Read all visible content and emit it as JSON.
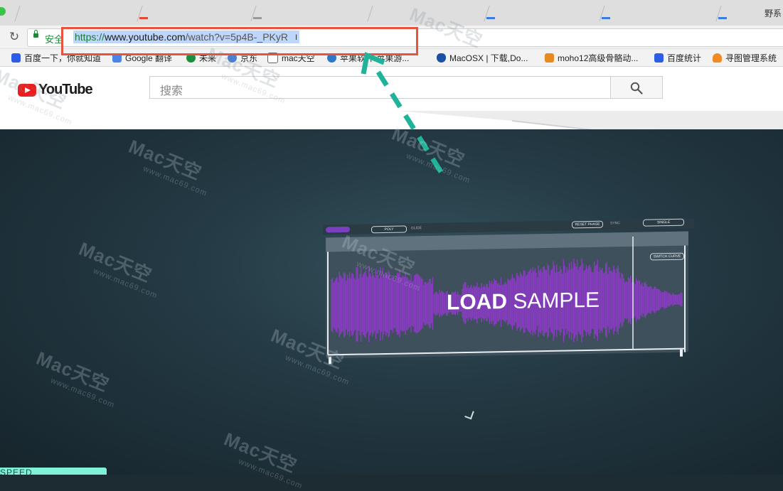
{
  "browser": {
    "corner_text": "野系",
    "secure_label": "安全",
    "url": {
      "scheme": "https://",
      "host": "www.youtube.com",
      "path": "/watch?v=5p4B-_PKyR"
    },
    "bookmarks": [
      {
        "label": "百度一下，你就知道",
        "color": "#2d5ce6"
      },
      {
        "label": "Google 翻译",
        "color": "#4a86e8"
      },
      {
        "label": "未来",
        "color": "#1c8f3c"
      },
      {
        "label": "京东",
        "color": "#4a7fd1"
      },
      {
        "label": "mac天空",
        "color": "#666666"
      },
      {
        "label": "苹果软件 苹果游...",
        "color": "#2d78c9"
      },
      {
        "label": "MacOSX | 下载,Do...",
        "color": "#1d4fa3"
      },
      {
        "label": "moho12高级骨骼动...",
        "color": "#e88a1f"
      },
      {
        "label": "百度统计",
        "color": "#2d5ce6"
      },
      {
        "label": "寻图管理系统",
        "color": "#f08a24"
      }
    ]
  },
  "youtube": {
    "logo_text": "YouTube",
    "search_placeholder": "搜索"
  },
  "video": {
    "load_sample_bold": "LOAD",
    "load_sample_rest": " SAMPLE",
    "speed_label": "SPEED",
    "plugin": {
      "poly_label": "POLY",
      "glide_label": "GLIDE",
      "reset_phase_label": "RESET PHASE",
      "sync_label": "SYNC",
      "single_label": "SINGLE",
      "switch_label": "SWITCH CURVE"
    }
  },
  "watermark": {
    "brand": "Mac天空",
    "site": "www.mac69.com"
  },
  "colors": {
    "annotation_red": "#e8533f",
    "annotation_arrow": "#1fb39a",
    "waveform_purple": "#8a3bc4",
    "youtube_red": "#ee1c1c"
  }
}
